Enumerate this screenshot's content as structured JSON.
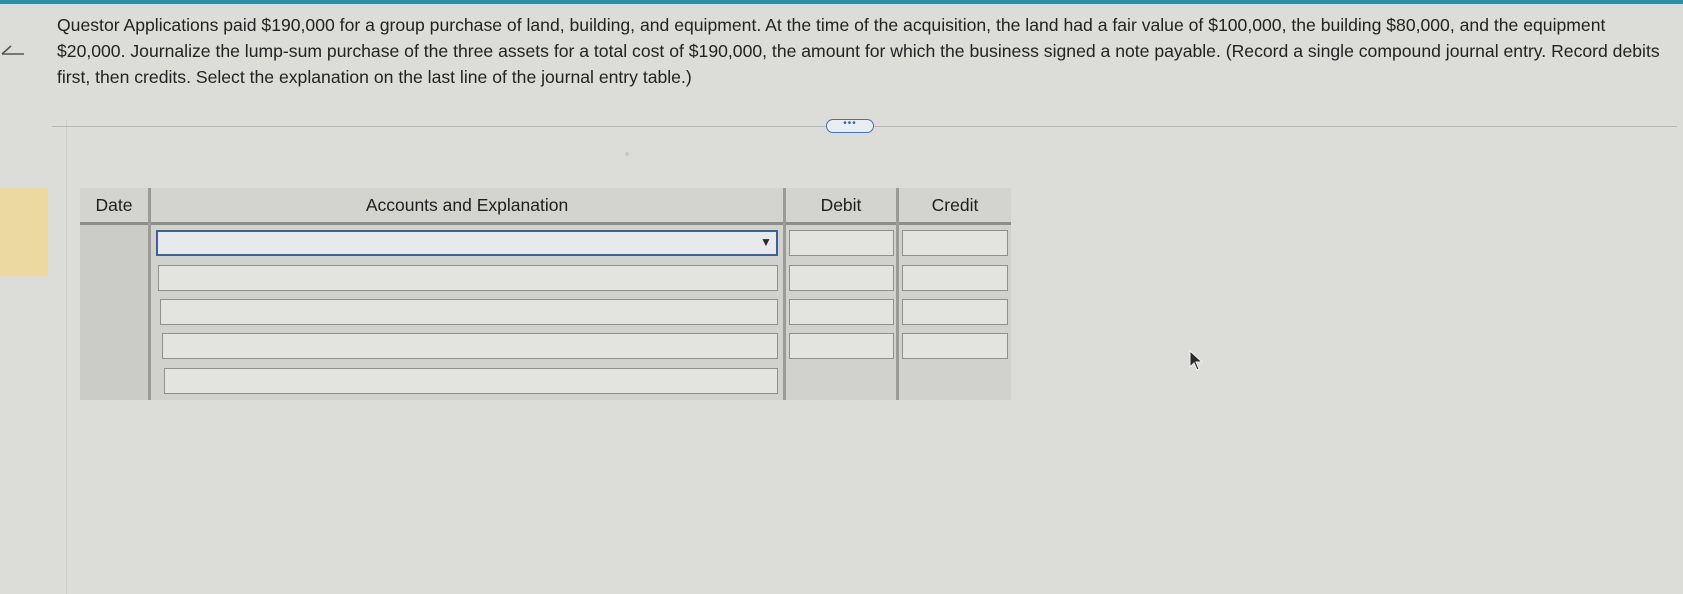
{
  "question": {
    "text": "Questor Applications paid $190,000 for a group purchase of land, building, and equipment. At the time of the acquisition, the land had a fair value of $100,000, the building $80,000, and the equipment $20,000. Journalize the lump-sum purchase of the three assets for a total cost of $190,000, the amount for which the business signed a note payable. (Record a single compound journal entry. Record debits first, then credits. Select the explanation on the last line of the journal entry table.)"
  },
  "more_button": {
    "label": "•••"
  },
  "journal": {
    "headers": {
      "date": "Date",
      "accounts": "Accounts and Explanation",
      "debit": "Debit",
      "credit": "Credit"
    },
    "select_arrow": "▼",
    "rows": [
      {
        "account": "",
        "debit": "",
        "credit": ""
      },
      {
        "account": "",
        "debit": "",
        "credit": ""
      },
      {
        "account": "",
        "debit": "",
        "credit": ""
      },
      {
        "account": "",
        "debit": "",
        "credit": ""
      },
      {
        "account": ""
      }
    ]
  },
  "icons": {
    "back": "back-arrow-icon",
    "cursor": "mouse-pointer-icon",
    "dropdown": "chevron-down-icon"
  },
  "colors": {
    "accent": "#2d8ea8",
    "active_field_border": "#3f5f9c",
    "header_bg": "#d3d3d0"
  }
}
